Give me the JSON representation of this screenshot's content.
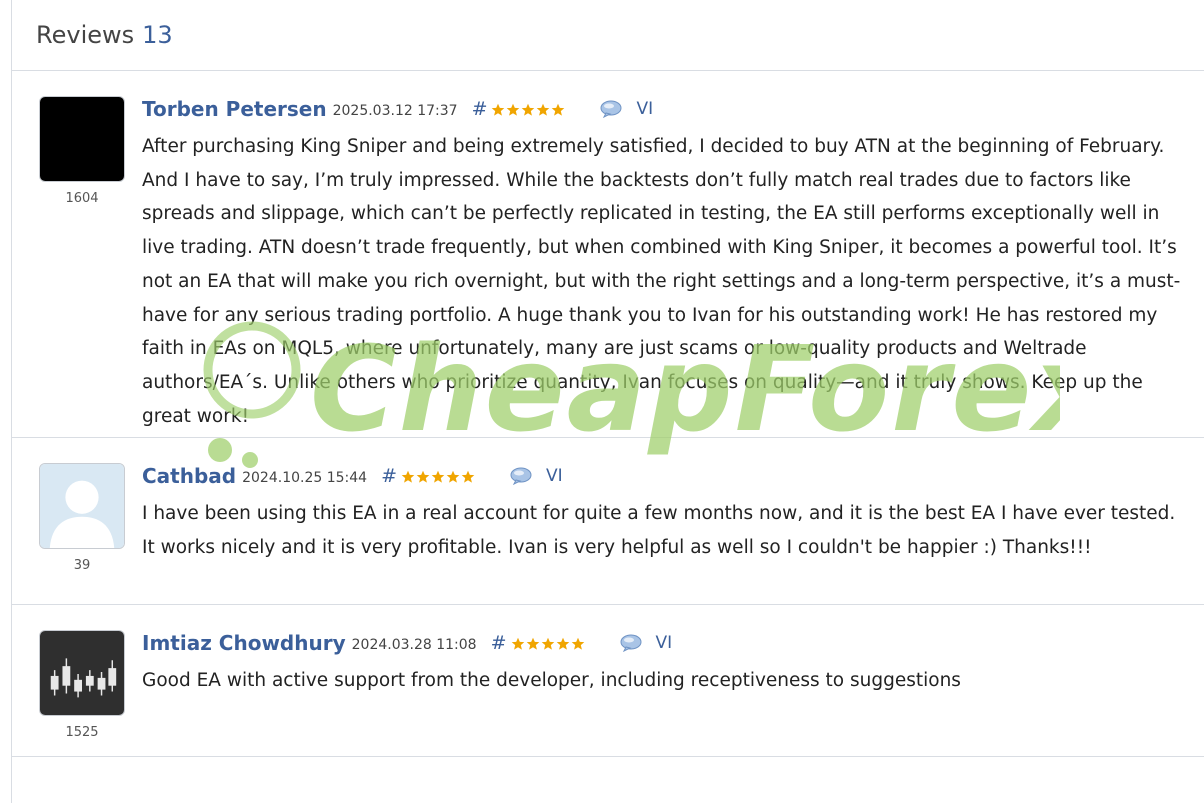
{
  "header": {
    "title": "Reviews",
    "count": "13"
  },
  "watermark": {
    "text": "CheapForexEa"
  },
  "reviews": [
    {
      "author": "Torben Petersen",
      "date": "2025.03.12 17:37",
      "hash": "#",
      "stars": 5,
      "lang": "VI",
      "rating": "1604",
      "avatar_icon": "black-square-avatar",
      "text": "After purchasing King Sniper and being extremely satisfied, I decided to buy ATN at the beginning of February. And I have to say, I’m truly impressed. While the backtests don’t fully match real trades due to factors like spreads and slippage, which can’t be perfectly replicated in testing, the EA still performs exceptionally well in live trading. ATN doesn’t trade frequently, but when combined with King Sniper, it becomes a powerful tool. It’s not an EA that will make you rich overnight, but with the right settings and a long-term perspective, it’s a must-have for any serious trading portfolio. A huge thank you to Ivan for his outstanding work! He has restored my faith in EAs on MQL5, where unfortunately, many are just scams or low-quality products and Weltrade authors/EA´s. Unlike others who prioritize quantity, Ivan focuses on quality—and it truly shows. Keep up the great work!"
    },
    {
      "author": "Cathbad",
      "date": "2024.10.25 15:44",
      "hash": "#",
      "stars": 5,
      "lang": "VI",
      "rating": "39",
      "avatar_icon": "default-user-avatar",
      "text": "I have been using this EA in a real account for quite a few months now, and it is the best EA I have ever tested. It works nicely and it is very profitable. Ivan is very helpful as well so I couldn't be happier :) Thanks!!!"
    },
    {
      "author": "Imtiaz Chowdhury",
      "date": "2024.03.28 11:08",
      "hash": "#",
      "stars": 5,
      "lang": "VI",
      "rating": "1525",
      "avatar_icon": "candlestick-chart-avatar",
      "text": "Good EA with active support from the developer, including receptiveness to suggestions"
    }
  ],
  "colors": {
    "link": "#3b5f9a",
    "star": "#f0a500",
    "divider": "#d9dde3",
    "watermark": "#9fcf6a"
  }
}
